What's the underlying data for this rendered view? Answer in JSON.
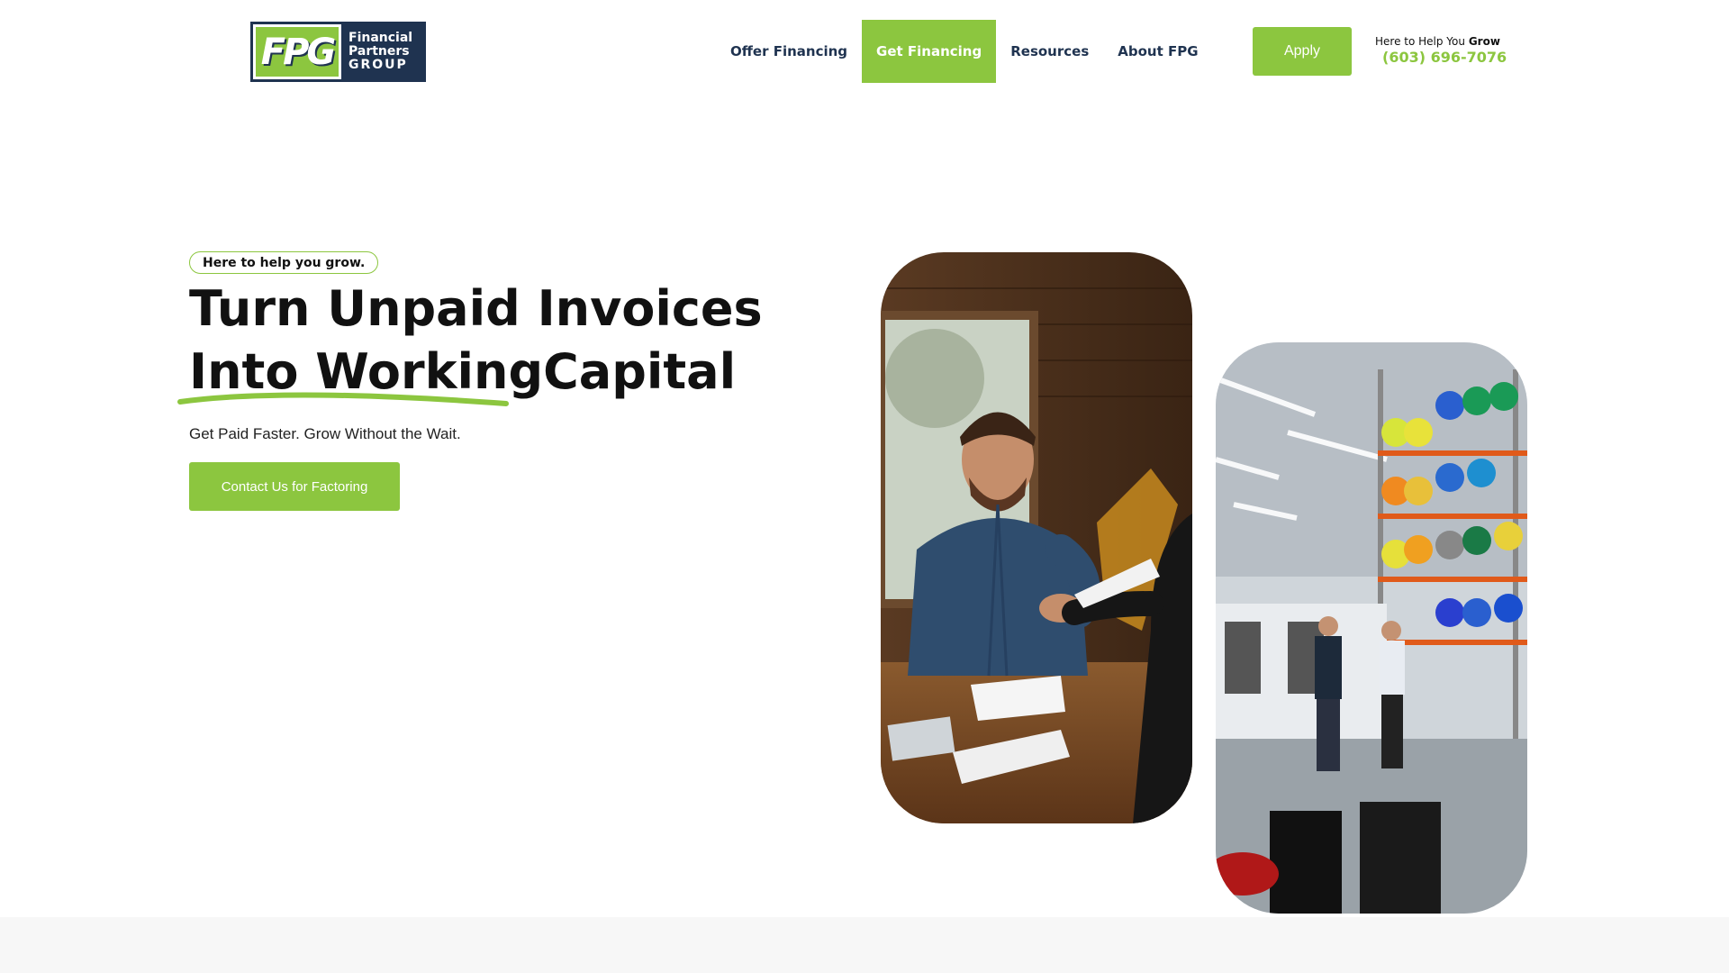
{
  "brand": {
    "logo_mark": "FPG",
    "logo_line1": "Financial",
    "logo_line2": "Partners",
    "logo_line3": "GROUP",
    "accent_color": "#8cc63f",
    "navy_color": "#1f3350"
  },
  "nav": {
    "items": [
      {
        "label": "Offer Financing"
      },
      {
        "label": "Get Financing"
      },
      {
        "label": "Resources"
      },
      {
        "label": "About FPG"
      }
    ]
  },
  "header": {
    "apply_label": "Apply",
    "help_text": "Here to Help You ",
    "help_bold": "Grow",
    "phone": "(603) 696-7076"
  },
  "hero": {
    "tagline": "Here to help you grow.",
    "headline_line1": "Turn Unpaid Invoices",
    "headline_line2": "Into WorkingCapital",
    "subhead": "Get Paid Faster. Grow Without the Wait.",
    "cta_label": "Contact Us for Factoring"
  },
  "images": {
    "photo1": "business-handshake-photo",
    "photo2": "factory-handshake-photo"
  }
}
